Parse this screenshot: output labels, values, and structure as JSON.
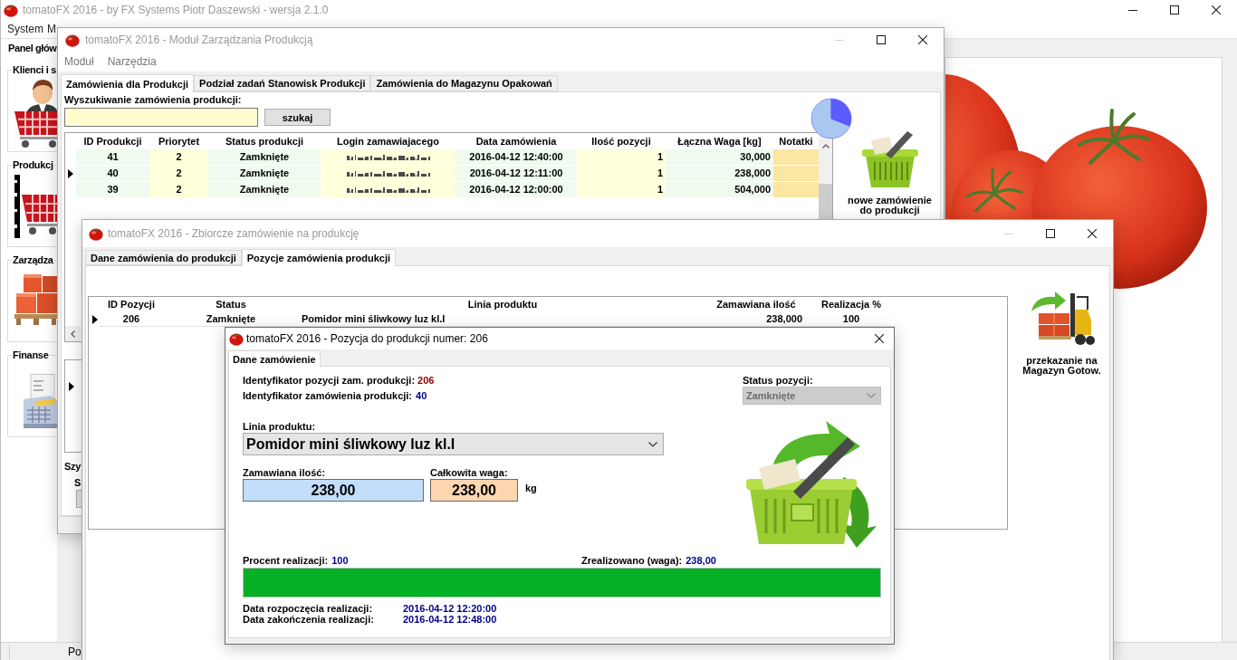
{
  "main_window": {
    "title": "tomatoFX 2016 - by FX Systems Piotr Daszewski - wersja 2.1.0",
    "active": false,
    "controls": [
      {
        "kind": "minimize",
        "disabled": false
      },
      {
        "kind": "maximize",
        "disabled": false
      },
      {
        "kind": "close",
        "disabled": false
      }
    ],
    "menu": [
      "System",
      "M"
    ],
    "panel_title": "Panel głów",
    "sidebar_groups": [
      {
        "label": "Klienci i s",
        "kind": "customers"
      },
      {
        "label": "Produkcj",
        "kind": "production"
      },
      {
        "label": "Zarządza",
        "kind": "warehouse"
      },
      {
        "label": "Finanse",
        "kind": "finance"
      }
    ],
    "status_bar": "Po"
  },
  "production_module_window": {
    "title": "tomatoFX 2016 - Moduł Zarządzania Produkcją",
    "active": false,
    "controls": [
      {
        "kind": "minimize",
        "disabled": true
      },
      {
        "kind": "maximize",
        "disabled": false
      },
      {
        "kind": "close",
        "disabled": false
      }
    ],
    "menu": [
      "Moduł",
      "Narzędzia"
    ],
    "tabs": [
      {
        "label": "Zamówienia dla Produkcji",
        "selected": true
      },
      {
        "label": "Podział zadań Stanowisk Produkcji",
        "selected": false
      },
      {
        "label": "Zamówienia do Magazynu Opakowań",
        "selected": false
      }
    ],
    "search_label": "Wyszukiwanie zamówienia produkcji:",
    "search_button": "szukaj",
    "orders_table": {
      "columns": [
        "ID Produkcji",
        "Priorytet",
        "Status produkcji",
        "Login zamawiajacego",
        "Data zamówienia",
        "Ilość pozycji",
        "Łączna Waga [kg]",
        "Notatki"
      ],
      "rows": [
        {
          "id": "41",
          "priority": "2",
          "status": "Zamknięte",
          "login_blurred": true,
          "date": "2016-04-12 12:40:00",
          "items": "1",
          "weight": "30,000",
          "selected": false
        },
        {
          "id": "40",
          "priority": "2",
          "status": "Zamknięte",
          "login_blurred": true,
          "date": "2016-04-12 12:11:00",
          "items": "1",
          "weight": "238,000",
          "selected": true
        },
        {
          "id": "39",
          "priority": "2",
          "status": "Zamknięte",
          "login_blurred": true,
          "date": "2016-04-12 12:00:00",
          "items": "1",
          "weight": "504,000",
          "selected": false
        }
      ]
    },
    "new_order_button": "nowe zamówienie do produkcji",
    "lower_table": {
      "rows": [
        {
          "selected": true
        }
      ]
    },
    "lower_label": "Szy",
    "lower_field_label": "S"
  },
  "collective_order_window": {
    "title": "tomatoFX 2016 - Zbiorcze zamówienie na produkcję",
    "active": false,
    "controls": [
      {
        "kind": "minimize",
        "disabled": true
      },
      {
        "kind": "maximize",
        "disabled": false
      },
      {
        "kind": "close",
        "disabled": false
      }
    ],
    "tabs": [
      {
        "label": "Dane zamówienia do produkcji",
        "selected": false
      },
      {
        "label": "Pozycje zamówienia produkcji",
        "selected": true
      }
    ],
    "positions_table": {
      "columns": [
        "ID Pozycji",
        "Status",
        "Linia produktu",
        "Zamawiana ilość",
        "Realizacja %"
      ],
      "rows": [
        {
          "id": "206",
          "status": "Zamknięte",
          "product_line": "Pomidor mini śliwkowy luz kl.I",
          "quantity": "238,000",
          "realization": "100",
          "selected": true
        }
      ]
    },
    "transfer_button": "przekazanie na Magazyn Gotow."
  },
  "position_dialog": {
    "title": "tomatoFX 2016 - Pozycja do produkcji numer: 206",
    "active": true,
    "controls": [
      {
        "kind": "close",
        "disabled": false
      }
    ],
    "tabs": [
      {
        "label": "Dane zamówienie",
        "selected": true
      }
    ],
    "position_id": {
      "label": "Identyfikator pozycji zam. produkcji:",
      "value": "206"
    },
    "order_id": {
      "label": "Identyfikator zamówienia produkcji:",
      "value": "40"
    },
    "status": {
      "label": "Status pozycji:",
      "value": "Zamknięte",
      "disabled": true
    },
    "product_line": {
      "label": "Linia produktu:",
      "value": "Pomidor mini śliwkowy luz kl.I"
    },
    "ordered_quantity": {
      "label": "Zamawiana ilość:",
      "value": "238,00"
    },
    "total_weight": {
      "label": "Całkowita waga:",
      "value": "238,00",
      "unit": "kg"
    },
    "realization_percent": {
      "label": "Procent realizacji:",
      "value": "100"
    },
    "realized_weight": {
      "label": "Zrealizowano (waga):",
      "value": "238,00"
    },
    "progress": {
      "level": 1
    },
    "start_date": {
      "label": "Data rozpoczęcia realizacji:",
      "value": "2016-04-12 12:20:00"
    },
    "end_date": {
      "label": "Data zakończenia realizacji:",
      "value": "2016-04-12 12:48:00"
    }
  }
}
